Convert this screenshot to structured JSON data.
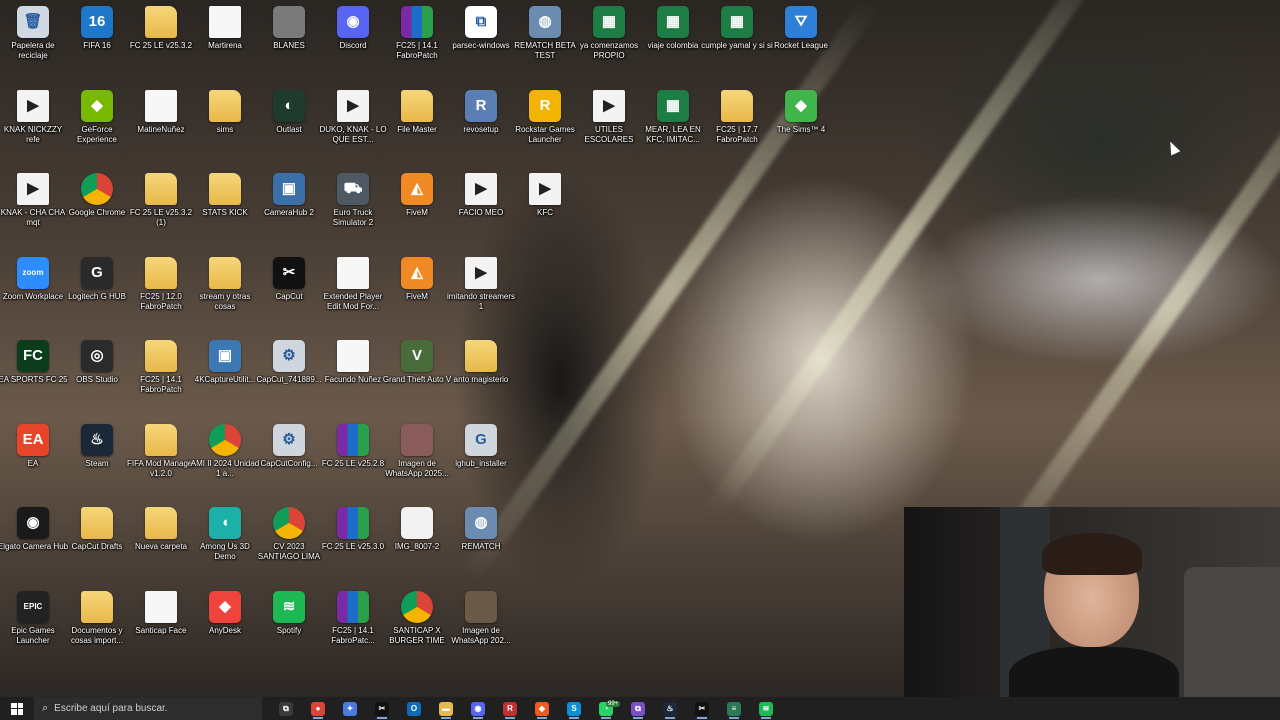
{
  "desktop": {
    "icons": [
      {
        "label": "Papelera de reciclaje",
        "icon": "recycle-bin-icon",
        "color": "#cfd8e3",
        "glyph": "🗑"
      },
      {
        "label": "FIFA 16",
        "icon": "fifa16-icon",
        "color": "#1f77c9",
        "glyph": "16"
      },
      {
        "label": "FC 25 LE v25.3.2",
        "icon": "folder-icon",
        "color": "",
        "glyph": ""
      },
      {
        "label": "Martirena",
        "icon": "file-icon",
        "color": "",
        "glyph": ""
      },
      {
        "label": "BLANES",
        "icon": "image-icon",
        "color": "#7a7a7a",
        "glyph": ""
      },
      {
        "label": "Discord",
        "icon": "discord-icon",
        "color": "#5865f2",
        "glyph": "◉"
      },
      {
        "label": "FC25 | 14.1 FabroPatch",
        "icon": "winrar-icon",
        "color": "",
        "glyph": ""
      },
      {
        "label": "parsec-windows",
        "icon": "parsec-icon",
        "color": "#ffffff",
        "glyph": "⧉"
      },
      {
        "label": "REMATCH BETA TEST",
        "icon": "rematch-icon",
        "color": "#6b8bb0",
        "glyph": "◍"
      },
      {
        "label": "ya comenzamos PROPIO",
        "icon": "spreadsheet-icon",
        "color": "#1d7d45",
        "glyph": "▦"
      },
      {
        "label": "viaje colombia",
        "icon": "spreadsheet-icon",
        "color": "#1d7d45",
        "glyph": "▦"
      },
      {
        "label": "cumple yamal y si si",
        "icon": "spreadsheet-icon",
        "color": "#1d7d45",
        "glyph": "▦"
      },
      {
        "label": "Rocket League",
        "icon": "rocket-league-icon",
        "color": "#2d7fd8",
        "glyph": "⛛"
      },
      {
        "label": "KNAK NICKZZY refe",
        "icon": "video-icon",
        "color": "",
        "glyph": "▶"
      },
      {
        "label": "GeForce Experience",
        "icon": "geforce-icon",
        "color": "#76b900",
        "glyph": "◆"
      },
      {
        "label": "MatineNuñez",
        "icon": "file-icon",
        "color": "",
        "glyph": ""
      },
      {
        "label": "sims",
        "icon": "folder-icon",
        "color": "",
        "glyph": ""
      },
      {
        "label": "Outlast",
        "icon": "outlast-icon",
        "color": "#1f3a2f",
        "glyph": "◐"
      },
      {
        "label": "DUKO, KNAK - LO QUE EST...",
        "icon": "video-icon",
        "color": "",
        "glyph": "▶"
      },
      {
        "label": "File Master",
        "icon": "folder-icon",
        "color": "",
        "glyph": ""
      },
      {
        "label": "revosetup",
        "icon": "revo-icon",
        "color": "#5b7fb5",
        "glyph": "R"
      },
      {
        "label": "Rockstar Games Launcher",
        "icon": "rockstar-icon",
        "color": "#f2b400",
        "glyph": "R"
      },
      {
        "label": "UTILES ESCOLARES",
        "icon": "video-icon",
        "color": "",
        "glyph": "▶"
      },
      {
        "label": "MEAR, LEA EN KFC, IMITAC...",
        "icon": "spreadsheet-icon",
        "color": "#1d7d45",
        "glyph": "▦"
      },
      {
        "label": "FC25 | 17.7 FabroPatch",
        "icon": "folder-icon",
        "color": "",
        "glyph": ""
      },
      {
        "label": "The Sims™ 4",
        "icon": "sims-icon",
        "color": "#3fb54a",
        "glyph": "◆"
      },
      {
        "label": "KNAK - CHA CHA mqt",
        "icon": "video-icon",
        "color": "",
        "glyph": "▶"
      },
      {
        "label": "Google Chrome",
        "icon": "chrome-icon",
        "color": "",
        "glyph": ""
      },
      {
        "label": "FC 25 LE v25.3.2 (1)",
        "icon": "folder-icon",
        "color": "",
        "glyph": ""
      },
      {
        "label": "STATS KICK",
        "icon": "folder-icon",
        "color": "",
        "glyph": ""
      },
      {
        "label": "CameraHub 2",
        "icon": "camerahub-icon",
        "color": "#3a6fa8",
        "glyph": "▣"
      },
      {
        "label": "Euro Truck Simulator 2",
        "icon": "ets2-icon",
        "color": "#4d5a66",
        "glyph": "⛟"
      },
      {
        "label": "FiveM",
        "icon": "fivem-icon",
        "color": "#f08a24",
        "glyph": "◭"
      },
      {
        "label": "FACIO MEO",
        "icon": "video-icon",
        "color": "",
        "glyph": "▶"
      },
      {
        "label": "KFC",
        "icon": "video-icon",
        "color": "",
        "glyph": "▶"
      },
      {
        "label": "Zoom Workplace",
        "icon": "zoom-icon",
        "color": "#2d8cff",
        "glyph": "zoom"
      },
      {
        "label": "Logitech G HUB",
        "icon": "logitech-icon",
        "color": "#2a2a2a",
        "glyph": "G"
      },
      {
        "label": "FC25 | 12.0 FabroPatch",
        "icon": "folder-icon",
        "color": "",
        "glyph": ""
      },
      {
        "label": "stream y otras cosas",
        "icon": "folder-icon",
        "color": "",
        "glyph": ""
      },
      {
        "label": "CapCut",
        "icon": "capcut-icon",
        "color": "#111111",
        "glyph": "✂"
      },
      {
        "label": "Extended Player Edit Mod For...",
        "icon": "file-icon",
        "color": "",
        "glyph": ""
      },
      {
        "label": "FiveM",
        "icon": "fivem-icon",
        "color": "#f08a24",
        "glyph": "◭"
      },
      {
        "label": "imitando streamers 1",
        "icon": "video-icon",
        "color": "",
        "glyph": "▶"
      },
      {
        "label": "EA SPORTS FC 25",
        "icon": "easfc-icon",
        "color": "#0b3d1c",
        "glyph": "FC"
      },
      {
        "label": "OBS Studio",
        "icon": "obs-icon",
        "color": "#2b2b2b",
        "glyph": "◎"
      },
      {
        "label": "FC25 | 14.1 FabroPatch",
        "icon": "folder-icon",
        "color": "",
        "glyph": ""
      },
      {
        "label": "4KCaptureUtilit...",
        "icon": "capture-icon",
        "color": "#3c78b4",
        "glyph": "▣"
      },
      {
        "label": "CapCut_741889...",
        "icon": "installer-icon",
        "color": "#cfd6de",
        "glyph": "⚙"
      },
      {
        "label": "Facundo Nuñez",
        "icon": "file-icon",
        "color": "",
        "glyph": ""
      },
      {
        "label": "Grand Theft Auto V",
        "icon": "gta-icon",
        "color": "#4a6b3a",
        "glyph": "V"
      },
      {
        "label": "anto magisterio",
        "icon": "folder-icon",
        "color": "",
        "glyph": ""
      },
      {
        "label": "EA",
        "icon": "ea-icon",
        "color": "#e8442a",
        "glyph": "EA"
      },
      {
        "label": "Steam",
        "icon": "steam-icon",
        "color": "#1b2838",
        "glyph": "♨"
      },
      {
        "label": "FIFA Mod Manager v1.2.0",
        "icon": "folder-icon",
        "color": "",
        "glyph": ""
      },
      {
        "label": "AMI II 2024 Unidad 1 a...",
        "icon": "chrome-icon",
        "color": "",
        "glyph": ""
      },
      {
        "label": "CapCutConfig...",
        "icon": "installer-icon",
        "color": "#cfd6de",
        "glyph": "⚙"
      },
      {
        "label": "FC 25 LE v25.2.8",
        "icon": "winrar-icon",
        "color": "",
        "glyph": ""
      },
      {
        "label": "Imagen de WhatsApp 2025...",
        "icon": "image-icon",
        "color": "#8a5b5b",
        "glyph": ""
      },
      {
        "label": "lghub_installer",
        "icon": "installer-icon",
        "color": "#cfd6de",
        "glyph": "G"
      },
      {
        "label": "Elgato Camera Hub",
        "icon": "elgato-icon",
        "color": "#1a1a1a",
        "glyph": "◉"
      },
      {
        "label": "CapCut Drafts",
        "icon": "folder-icon",
        "color": "",
        "glyph": ""
      },
      {
        "label": "Nueva carpeta",
        "icon": "folder-icon",
        "color": "",
        "glyph": ""
      },
      {
        "label": "Among Us 3D Demo",
        "icon": "amongus-icon",
        "color": "#1bb0a8",
        "glyph": "◖"
      },
      {
        "label": "CV 2023 SANTIAGO LIMA",
        "icon": "chrome-icon",
        "color": "",
        "glyph": ""
      },
      {
        "label": "FC 25 LE v25.3.0",
        "icon": "winrar-icon",
        "color": "",
        "glyph": ""
      },
      {
        "label": "IMG_8007-2",
        "icon": "image-icon",
        "color": "#f2f2f2",
        "glyph": ""
      },
      {
        "label": "REMATCH",
        "icon": "rematch-icon",
        "color": "#6b8bb0",
        "glyph": "◍"
      },
      {
        "label": "Epic Games Launcher",
        "icon": "epic-icon",
        "color": "#222222",
        "glyph": "EPIC"
      },
      {
        "label": "Documentos y cosas import...",
        "icon": "folder-icon",
        "color": "",
        "glyph": ""
      },
      {
        "label": "Santicap Face",
        "icon": "file-icon",
        "color": "",
        "glyph": ""
      },
      {
        "label": "AnyDesk",
        "icon": "anydesk-icon",
        "color": "#ef443b",
        "glyph": "◆"
      },
      {
        "label": "Spotify",
        "icon": "spotify-icon",
        "color": "#1db954",
        "glyph": "≋"
      },
      {
        "label": "FC25 | 14.1 FabroPatc...",
        "icon": "winrar-icon",
        "color": "",
        "glyph": ""
      },
      {
        "label": "SANTICAP X BURGER TIME",
        "icon": "chrome-icon",
        "color": "",
        "glyph": ""
      },
      {
        "label": "Imagen de WhatsApp 202...",
        "icon": "image-icon",
        "color": "#6b5a48",
        "glyph": ""
      }
    ]
  },
  "taskbar": {
    "search_placeholder": "Escribe aquí para buscar.",
    "apps": [
      {
        "name": "task-view-icon",
        "color": "#3a3a3a",
        "glyph": "⧉"
      },
      {
        "name": "chrome-icon",
        "color": "#db4437",
        "glyph": "●"
      },
      {
        "name": "copilot-icon",
        "color": "#4a7ae0",
        "glyph": "✦"
      },
      {
        "name": "capcut-icon",
        "color": "#111111",
        "glyph": "✂"
      },
      {
        "name": "outlook-icon",
        "color": "#0f6cbd",
        "glyph": "O"
      },
      {
        "name": "file-explorer-icon",
        "color": "#e8b84a",
        "glyph": "▬"
      },
      {
        "name": "discord-icon",
        "color": "#5865f2",
        "glyph": "◉"
      },
      {
        "name": "rockstar-icon",
        "color": "#c23030",
        "glyph": "R"
      },
      {
        "name": "brave-icon",
        "color": "#f05c1e",
        "glyph": "◆"
      },
      {
        "name": "skype-icon",
        "color": "#0a8fd8",
        "glyph": "S"
      },
      {
        "name": "whatsapp-icon",
        "color": "#25d366",
        "glyph": "◔",
        "badge": "99+"
      },
      {
        "name": "parsec-icon",
        "color": "#7a4fc8",
        "glyph": "⧉"
      },
      {
        "name": "steam-icon",
        "color": "#1b2838",
        "glyph": "♨"
      },
      {
        "name": "capcut-icon",
        "color": "#111111",
        "glyph": "✂"
      },
      {
        "name": "notepad-icon",
        "color": "#2a7a5a",
        "glyph": "≡"
      },
      {
        "name": "spotify-icon",
        "color": "#1db954",
        "glyph": "≋"
      }
    ]
  }
}
